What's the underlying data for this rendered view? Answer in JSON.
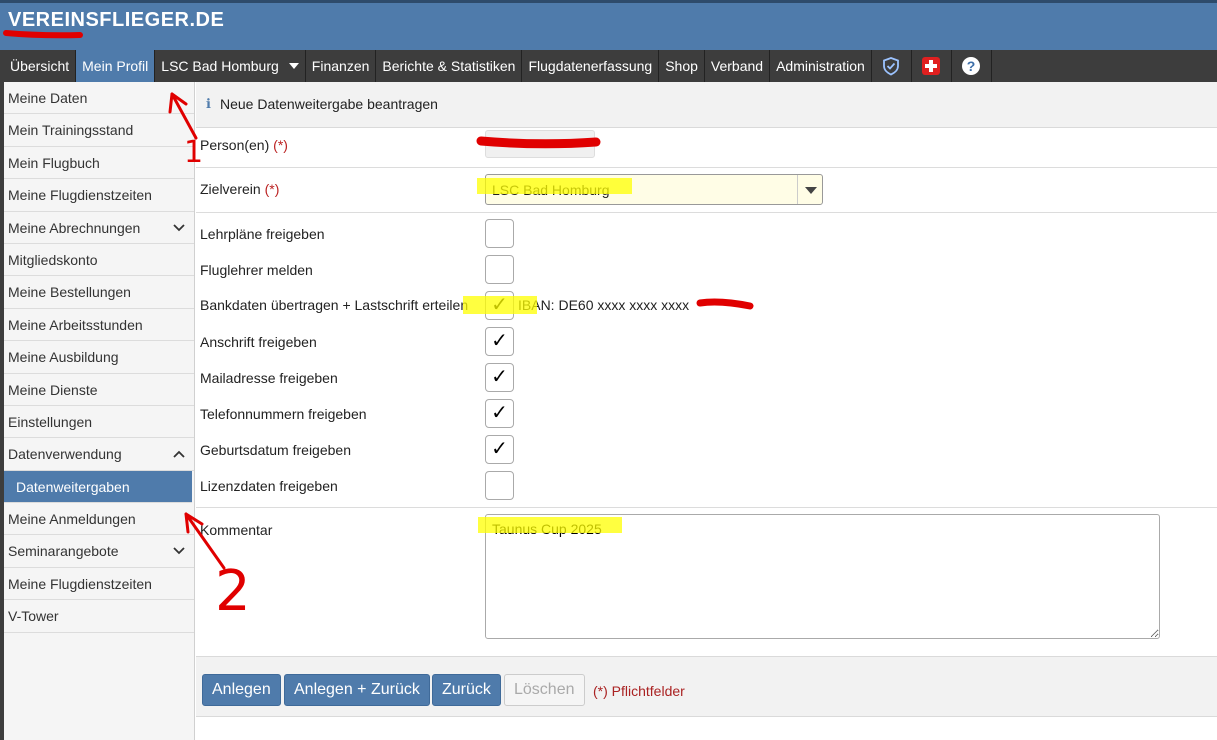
{
  "app": {
    "logo": "VEREINSFLIEGER.DE"
  },
  "nav": {
    "items": [
      "Übersicht",
      "Mein Profil",
      "LSC Bad Homburg",
      "Finanzen",
      "Berichte & Statistiken",
      "Flugdatenerfassung",
      "Shop",
      "Verband",
      "Administration"
    ],
    "active": "Mein Profil",
    "icons": [
      "shield-check-icon",
      "first-aid-icon",
      "help-icon"
    ]
  },
  "sidebar": {
    "items": [
      "Meine Daten",
      "Mein Trainingsstand",
      "Mein Flugbuch",
      "Meine Flugdienstzeiten",
      "Meine Abrechnungen",
      "Mitgliedskonto",
      "Meine Bestellungen",
      "Meine Arbeitsstunden",
      "Meine Ausbildung",
      "Meine Dienste",
      "Einstellungen",
      "Datenverwendung",
      "Datenweitergaben",
      "Meine Anmeldungen",
      "Seminarangebote",
      "Meine Flugdienstzeiten",
      "V-Tower"
    ],
    "selected": "Datenweitergaben"
  },
  "form": {
    "title": "Neue Datenweitergabe beantragen",
    "person_label": "Person(en)",
    "required_mark": "(*)",
    "zielverein_label": "Zielverein",
    "zielverein_value": "LSC Bad Homburg",
    "checkboxes": [
      {
        "label": "Lehrpläne freigeben",
        "checked": false
      },
      {
        "label": "Fluglehrer melden",
        "checked": false
      },
      {
        "label": "Bankdaten übertragen + Lastschrift erteilen",
        "checked": true
      },
      {
        "label": "Anschrift freigeben",
        "checked": true
      },
      {
        "label": "Mailadresse freigeben",
        "checked": true
      },
      {
        "label": "Telefonnummern freigeben",
        "checked": true
      },
      {
        "label": "Geburtsdatum freigeben",
        "checked": true
      },
      {
        "label": "Lizenzdaten freigeben",
        "checked": false
      }
    ],
    "iban_text": "IBAN: DE60 xxxx xxxx xxxx",
    "check_glyph": "✓",
    "kommentar_label": "Kommentar",
    "kommentar_value": "Taunus Cup 2025",
    "buttons": {
      "anlegen": "Anlegen",
      "anlegen_zurueck": "Anlegen + Zurück",
      "zurueck": "Zurück",
      "loeschen": "Löschen"
    },
    "pflichtfelder": "(*) Pflichtfelder"
  },
  "annotations": {
    "marker1": "1",
    "marker2": "2"
  },
  "colors": {
    "brand": "#4f7bab",
    "nav": "#3d3d3d",
    "annotation_red": "#e00000",
    "highlight_yellow": "#ffff00"
  }
}
